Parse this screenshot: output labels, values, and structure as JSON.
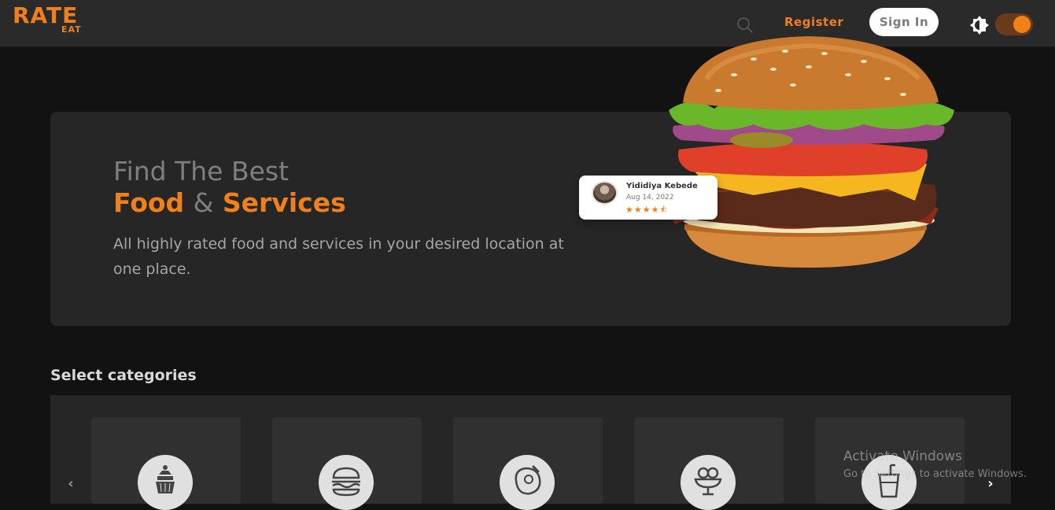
{
  "header": {
    "logo_main": "RATE",
    "logo_sub": "EAT",
    "register_label": "Register",
    "signin_label": "Sign In"
  },
  "hero": {
    "line1": "Find The Best",
    "line2_part1": "Food",
    "line2_amp": "&",
    "line2_part2": "Services",
    "description": "All highly rated food and services in your desired location at one place."
  },
  "review_card": {
    "name": "Yididiya Kebede",
    "date": "Aug 14, 2022",
    "rating": 4.5
  },
  "categories": {
    "title": "Select categories",
    "items": [
      {
        "icon": "dessert-tower-icon"
      },
      {
        "icon": "burger-icon"
      },
      {
        "icon": "meat-icon"
      },
      {
        "icon": "ice-cream-icon"
      },
      {
        "icon": "drink-cup-icon"
      }
    ]
  },
  "watermark": {
    "line1": "Activate Windows",
    "line2": "Go to Settings to activate Windows."
  },
  "colors": {
    "accent": "#f0801a",
    "background": "#121212",
    "header_bg": "#2a2a2a",
    "panel_bg": "#262626"
  }
}
